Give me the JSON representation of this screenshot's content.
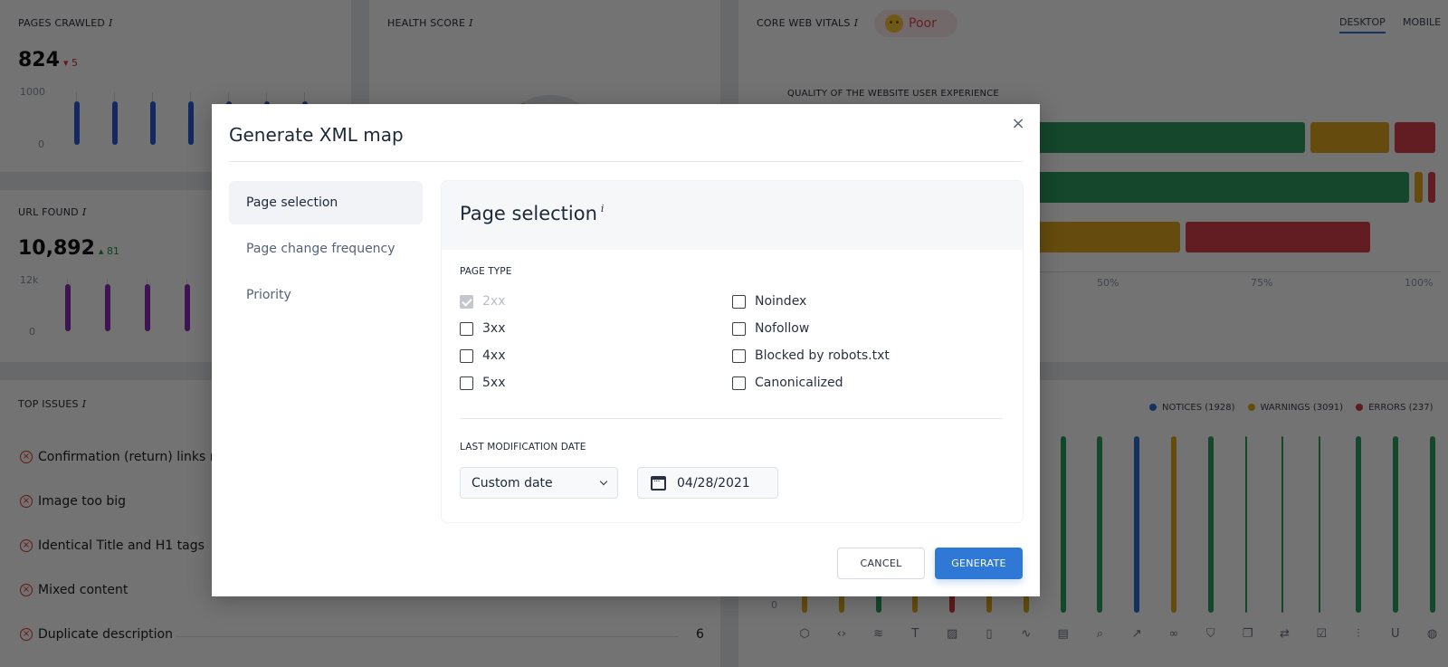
{
  "dashboard": {
    "pages_crawled": {
      "title": "PAGES CRAWLED",
      "info": "i",
      "value": "824",
      "delta": "5",
      "delta_direction": "down",
      "axis_top": "1000",
      "axis_bottom": "0",
      "bar_values": [
        820,
        820,
        820,
        820,
        820,
        820,
        824
      ],
      "axis_max": 1000
    },
    "url_found": {
      "title": "URL FOUND",
      "info": "i",
      "value": "10,892",
      "delta": "81",
      "delta_direction": "up",
      "axis_top": "12k",
      "axis_bottom": "0",
      "bar_values": [
        10811,
        10811,
        10811,
        10811
      ],
      "axis_max": 12000
    },
    "health_score": {
      "title": "HEALTH SCORE",
      "info": "i"
    },
    "core_web_vitals": {
      "title": "CORE WEB VITALS",
      "info": "i",
      "badge": "Poor",
      "tabs": [
        "DESKTOP",
        "MOBILE"
      ],
      "active_tab": "DESKTOP",
      "subtitle": "QUALITY OF THE WEBSITE USER EXPERIENCE",
      "x_ticks": [
        "50%",
        "75%",
        "100%"
      ],
      "rows": [
        {
          "good": 80,
          "needs_improvement": 13,
          "poor": 7
        },
        {
          "good": 96,
          "needs_improvement": 2,
          "poor": 2
        },
        {
          "good": 30,
          "needs_improvement": 31,
          "poor": 29
        }
      ],
      "colors": {
        "good": "#2e9e62",
        "needs_improvement": "#e0a820",
        "poor": "#d9404f"
      }
    },
    "top_issues": {
      "title": "TOP ISSUES",
      "info": "i",
      "items": [
        {
          "label": "Confirmation (return) links mis",
          "count": ""
        },
        {
          "label": "Image too big",
          "count": ""
        },
        {
          "label": "Identical Title and H1 tags",
          "count": ""
        },
        {
          "label": "Mixed content",
          "count": ""
        },
        {
          "label": "Duplicate description",
          "count": "6"
        }
      ]
    },
    "issues_chart": {
      "legend": [
        {
          "label": "NOTICES (1928)",
          "color": "#2a6fd6"
        },
        {
          "label": "WARNINGS (3091)",
          "color": "#e0a820"
        },
        {
          "label": "ERRORS (237)",
          "color": "#d33b3b"
        }
      ],
      "axis_zero": "0",
      "category_icons": [
        "cube-icon",
        "code-icon",
        "wind-icon",
        "text-icon",
        "image-icon",
        "mobile-icon",
        "pulse-icon",
        "document-icon",
        "search-icon",
        "external-link-icon",
        "link-icon",
        "shield-icon",
        "copy-icon",
        "repeat-icon",
        "checkbox-icon",
        "sliders-icon",
        "underline-icon",
        "globe-icon"
      ]
    }
  },
  "modal": {
    "title": "Generate XML map",
    "close_label": "×",
    "sidebar": [
      {
        "label": "Page selection",
        "active": true
      },
      {
        "label": "Page change frequency",
        "active": false
      },
      {
        "label": "Priority",
        "active": false
      }
    ],
    "section_title": "Page selection",
    "section_info": "i",
    "page_type_label": "PAGE TYPE",
    "page_types_left": [
      {
        "label": "2xx",
        "checked": true,
        "disabled": true
      },
      {
        "label": "3xx",
        "checked": false,
        "disabled": false
      },
      {
        "label": "4xx",
        "checked": false,
        "disabled": false
      },
      {
        "label": "5xx",
        "checked": false,
        "disabled": false
      }
    ],
    "page_types_right": [
      {
        "label": "Noindex",
        "checked": false
      },
      {
        "label": "Nofollow",
        "checked": false
      },
      {
        "label": "Blocked by robots.txt",
        "checked": false
      },
      {
        "label": "Canonicalized",
        "checked": false
      }
    ],
    "last_mod_label": "LAST MODIFICATION DATE",
    "date_mode": "Custom date",
    "date_value": "04/28/2021",
    "cancel_label": "CANCEL",
    "generate_label": "GENERATE"
  }
}
